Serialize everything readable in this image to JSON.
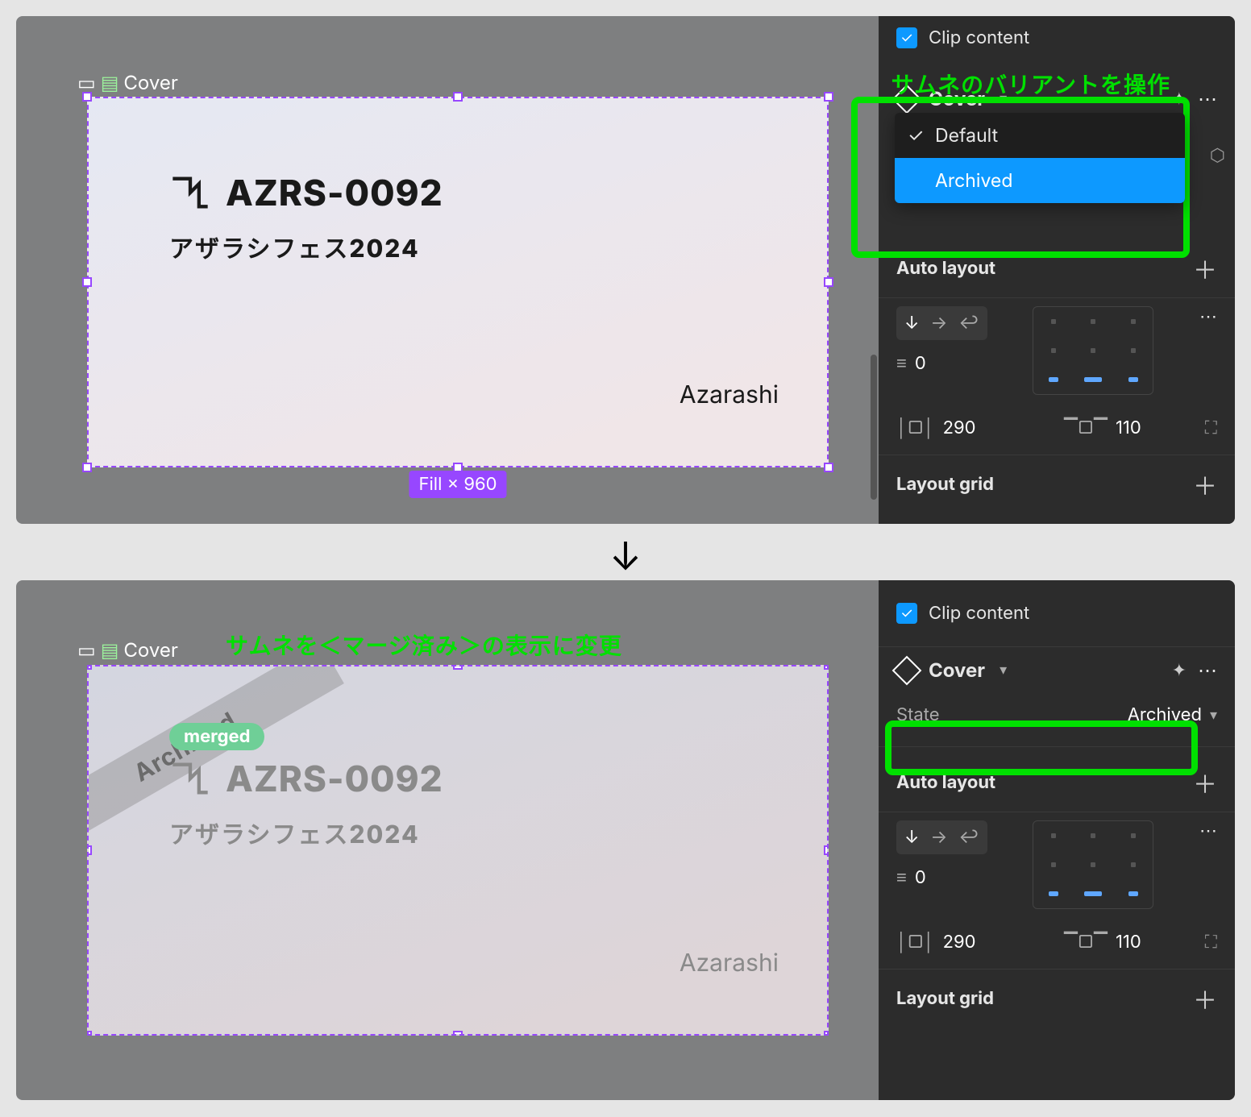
{
  "frame_label": "Cover",
  "card": {
    "code": "AZRS-0092",
    "ja_title": "アザラシフェス2024",
    "byline": "Azarashi",
    "merged_label": "merged",
    "ribbon_text": "Archived"
  },
  "size_pill": "Fill × 960",
  "inspector": {
    "clip_content": "Clip content",
    "component_name": "Cover",
    "variant_options": [
      "Default",
      "Archived"
    ],
    "state_prop_label": "State",
    "state_prop_value": "Archived",
    "auto_layout_label": "Auto layout",
    "layout_grid_label": "Layout grid",
    "spacing_gap": "0",
    "padding_h": "290",
    "padding_v": "110"
  },
  "annotations": {
    "top": "サムネのバリアントを操作",
    "bottom": "サムネを＜マージ済み＞の表示に変更"
  }
}
